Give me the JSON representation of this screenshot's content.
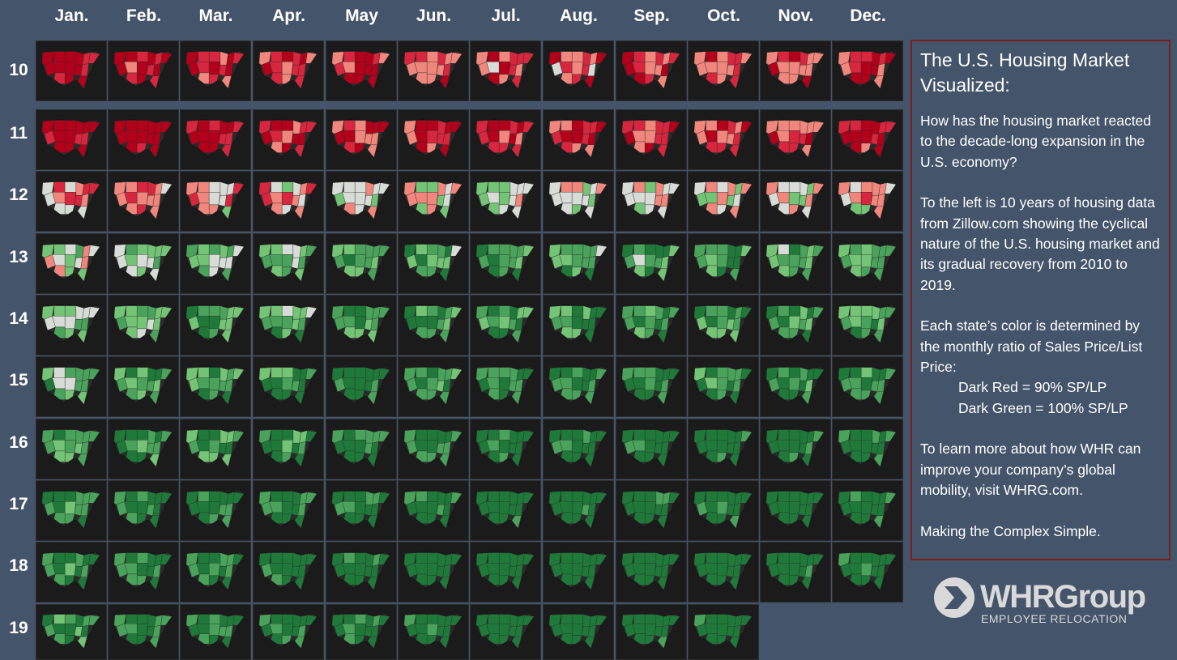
{
  "months": [
    "Jan.",
    "Feb.",
    "Mar.",
    "Apr.",
    "May",
    "Jun.",
    "Jul.",
    "Aug.",
    "Sep.",
    "Oct.",
    "Nov.",
    "Dec."
  ],
  "years": [
    "10",
    "11",
    "12",
    "13",
    "14",
    "15",
    "16",
    "17",
    "18",
    "19"
  ],
  "last_year_month_count": 10,
  "year_status": [
    {
      "year": "10",
      "level": 0.15
    },
    {
      "year": "11",
      "level": 0.1
    },
    {
      "year": "12",
      "level": 0.4
    },
    {
      "year": "13",
      "level": 0.62
    },
    {
      "year": "14",
      "level": 0.7
    },
    {
      "year": "15",
      "level": 0.78
    },
    {
      "year": "16",
      "level": 0.84
    },
    {
      "year": "17",
      "level": 0.9
    },
    {
      "year": "18",
      "level": 0.94
    },
    {
      "year": "19",
      "level": 0.92
    }
  ],
  "colors": {
    "background": "#44546a",
    "map_background": "#1e1e1e",
    "dark_red": "#b3001b",
    "light_red": "#f1877c",
    "neutral": "#d8dcd6",
    "light_green": "#74c476",
    "dark_green": "#1f7a3a",
    "panel_border": "#7b1d1d"
  },
  "info": {
    "title": "The U.S. Housing Market Visualized:",
    "p1": "How has the housing market reacted to the decade-long expansion in the U.S. economy?",
    "p2": "To the left is 10 years of housing data from Zillow.com showing the cyclical nature of the U.S. housing market and its gradual recovery from 2010 to 2019.",
    "p3": "Each state’s color is determined by the monthly ratio of Sales Price/List Price:",
    "legend_red": "Dark Red = 90% SP/LP",
    "legend_green": "Dark Green = 100% SP/LP",
    "p4": "To learn more about how WHR can improve your company’s global mobility, visit WHRG.com.",
    "p5": "Making the Complex Simple."
  },
  "logo": {
    "wordmark": "WHRGroup",
    "tagline": "EMPLOYEE RELOCATION"
  }
}
